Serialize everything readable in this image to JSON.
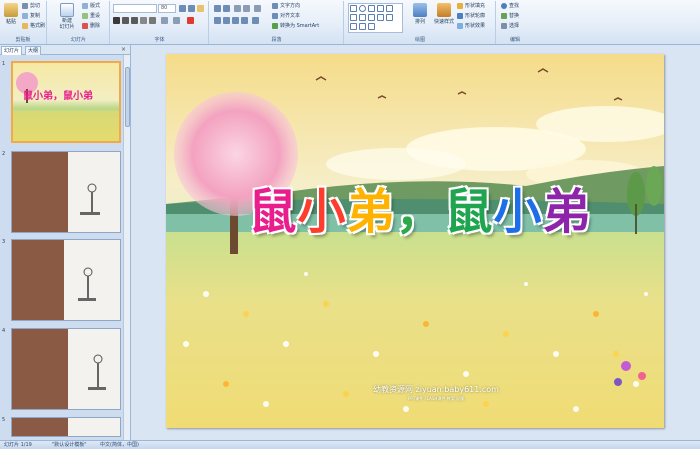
{
  "ribbon": {
    "clipboard": {
      "paste": "粘贴",
      "cut": "剪切",
      "copy": "复制",
      "format_painter": "格式刷",
      "group": "剪贴板"
    },
    "slides": {
      "new_slide": "新建\n幻灯片",
      "layout": "版式",
      "reset": "重设",
      "delete": "删除",
      "group": "幻灯片"
    },
    "font": {
      "size": "80",
      "group": "字体"
    },
    "paragraph": {
      "text_direction": "文字方向",
      "align_text": "对齐文本",
      "smartart": "转换为 SmartArt",
      "group": "段落"
    },
    "drawing": {
      "arrange": "排列",
      "quick_styles": "快速样式",
      "shape_fill": "形状填充",
      "shape_outline": "形状轮廓",
      "shape_effects": "形状效果",
      "group": "绘图"
    },
    "editing": {
      "find": "查找",
      "replace": "替换",
      "select": "选择",
      "group": "编辑"
    }
  },
  "panel": {
    "tab_slides": "幻灯片",
    "tab_outline": "大纲",
    "slide_numbers": [
      "1",
      "2",
      "3",
      "4",
      "5"
    ]
  },
  "slide": {
    "title": "鼠小弟，鼠小弟",
    "title_chars": [
      {
        "ch": "鼠",
        "color": "#e91e8c"
      },
      {
        "ch": "小",
        "color": "#ff3d2e"
      },
      {
        "ch": "弟",
        "color": "#ffb300"
      },
      {
        "ch": "，",
        "color": "#2ea84a"
      },
      {
        "ch": "鼠",
        "color": "#1fa44f"
      },
      {
        "ch": "小",
        "color": "#1e6ee8"
      },
      {
        "ch": "弟",
        "color": "#8e24aa"
      }
    ],
    "watermark": "幼教资源网 ziyuan.baby611.com",
    "watermark_sub": "PPT课件 FLASH课件 教案 说课"
  },
  "status": {
    "slide_counter": "幻灯片 1/19",
    "theme": "\"默认设计模板\"",
    "language": "中文(简体，中国)"
  }
}
